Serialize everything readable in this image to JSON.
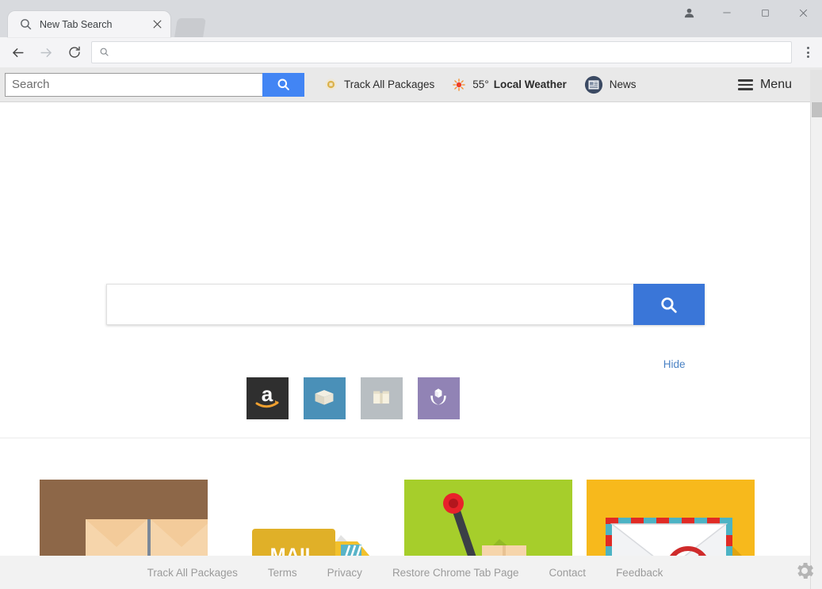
{
  "window": {
    "tab": {
      "title": "New Tab Search",
      "favicon_icon": "search-icon",
      "close_icon": "close-icon"
    },
    "controls": {
      "profile_icon": "profile-avatar-icon",
      "minimize_icon": "minimize-icon",
      "maximize_icon": "maximize-icon",
      "close_icon": "close-icon"
    }
  },
  "toolbar": {
    "back_icon": "back-arrow-icon",
    "forward_icon": "forward-arrow-icon",
    "reload_icon": "reload-icon",
    "omnibox": {
      "value": "",
      "placeholder": "",
      "icon": "search-icon"
    },
    "menu_icon": "three-dot-menu-icon"
  },
  "extension_bar": {
    "search": {
      "value": "",
      "placeholder": "Search",
      "button_icon": "search-icon",
      "button_color": "#4285f4"
    },
    "items": [
      {
        "label": "Track All Packages",
        "icon": "package-icon"
      },
      {
        "label": "Local Weather",
        "prefix": "55°",
        "icon": "sun-icon"
      },
      {
        "label": "News",
        "icon": "newspaper-icon"
      }
    ],
    "menu": {
      "label": "Menu",
      "icon": "hamburger-menu-icon"
    }
  },
  "main": {
    "search": {
      "value": "",
      "placeholder": "",
      "button_icon": "search-icon",
      "button_color": "#3a76d8"
    },
    "hide_label": "Hide",
    "hide_color": "#4a82c4",
    "tiles": [
      {
        "name": "amazon",
        "icon": "amazon-logo-icon",
        "bg": "#2f2f2f"
      },
      {
        "name": "open-box",
        "icon": "open-box-icon",
        "bg": "#4a90b8"
      },
      {
        "name": "carton",
        "icon": "carton-box-icon",
        "bg": "#b8bec2"
      },
      {
        "name": "hands-package",
        "icon": "hands-holding-package-icon",
        "bg": "#9183b5"
      }
    ],
    "cards": [
      {
        "name": "stacked-boxes",
        "bg": "#8d6748"
      },
      {
        "name": "mail-truck",
        "bg": "#ffffff",
        "text": "MAIL"
      },
      {
        "name": "tracking-pin",
        "bg": "#a6ce2b"
      },
      {
        "name": "airmail-envelope",
        "bg": "#f7b91c"
      }
    ]
  },
  "footer": {
    "links": [
      "Track All Packages",
      "Terms",
      "Privacy",
      "Restore Chrome Tab Page",
      "Contact",
      "Feedback"
    ],
    "settings_icon": "gear-icon"
  }
}
